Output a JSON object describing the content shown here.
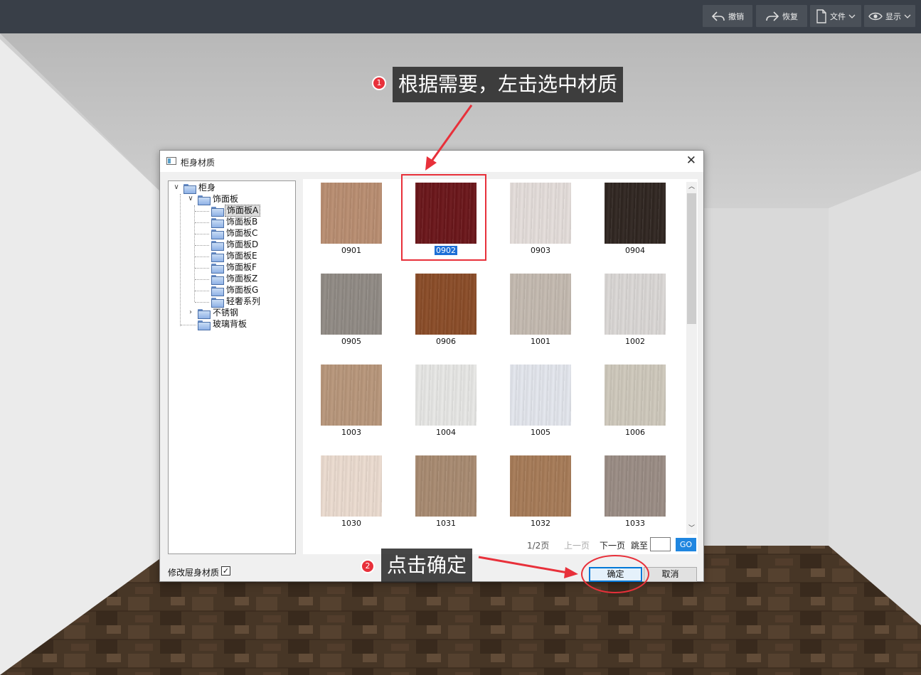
{
  "toolbar": {
    "undo_label": "撤销",
    "redo_label": "恢复",
    "file_label": "文件",
    "display_label": "显示"
  },
  "dialog": {
    "title": "柜身材质",
    "tree": {
      "root": "柜身",
      "group": "饰面板",
      "children": [
        "饰面板A",
        "饰面板B",
        "饰面板C",
        "饰面板D",
        "饰面板E",
        "饰面板F",
        "饰面板Z",
        "饰面板G",
        "轻奢系列"
      ],
      "selected": "饰面板A",
      "siblings": [
        "不锈钢",
        "玻璃背板"
      ]
    },
    "materials": [
      {
        "code": "0901",
        "color": "#b98d70"
      },
      {
        "code": "0902",
        "color": "#6a1418",
        "selected": true
      },
      {
        "code": "0903",
        "color": "#e5dedb"
      },
      {
        "code": "0904",
        "color": "#2e241f"
      },
      {
        "code": "0905",
        "color": "#908a84"
      },
      {
        "code": "0906",
        "color": "#8a4b26"
      },
      {
        "code": "1001",
        "color": "#c4bab0"
      },
      {
        "code": "1002",
        "color": "#dbd8d6"
      },
      {
        "code": "1003",
        "color": "#b8967a"
      },
      {
        "code": "1004",
        "color": "#e8e8e6"
      },
      {
        "code": "1005",
        "color": "#e4e7ee"
      },
      {
        "code": "1006",
        "color": "#cfc9bc"
      },
      {
        "code": "1030",
        "color": "#ecdcd0"
      },
      {
        "code": "1031",
        "color": "#a88a70"
      },
      {
        "code": "1032",
        "color": "#a67a56"
      },
      {
        "code": "1033",
        "color": "#9a8c84"
      }
    ],
    "pager": {
      "page": "1/2页",
      "prev": "上一页",
      "next": "下一页",
      "jump": "跳至",
      "go": "GO"
    },
    "modify_door_label": "修改屉身材质",
    "modify_door_checked": "✓",
    "ok_label": "确定",
    "cancel_label": "取消"
  },
  "annotations": {
    "step1_number": "1",
    "step1_text": "根据需要，左击选中材质",
    "step2_number": "2",
    "step2_text": "点击确定"
  },
  "colors": {
    "toolbar_bg": "#393f48",
    "accent": "#1f86e0",
    "annotation_red": "#e8303a"
  }
}
